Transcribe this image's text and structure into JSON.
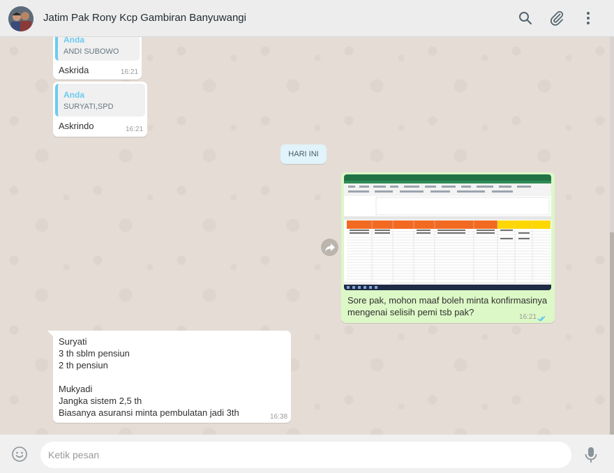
{
  "header": {
    "title": "Jatim Pak Rony Kcp Gambiran Banyuwangi",
    "icons": [
      "search-icon",
      "attach-icon",
      "menu-icon"
    ]
  },
  "messages": [
    {
      "quote_author": "Anda",
      "quote_text": "ANDI SUBOWO",
      "text": "Askrida",
      "time": "16:21"
    },
    {
      "quote_author": "Anda",
      "quote_text": "SURYATI,SPD",
      "text": "Askrindo",
      "time": "16:21"
    }
  ],
  "day_divider": "HARI INI",
  "outgoing": {
    "caption_line1": "Sore pak, mohon maaf boleh minta konfirmasinya",
    "caption_line2": "mengenai selisih pemi tsb pak?",
    "time": "16:21",
    "status_icon": "double-check-read-icon",
    "status_color": "#4fc3f7"
  },
  "incoming": {
    "lines": [
      "Suryati",
      "3 th sblm pensiun",
      "2 th pensiun",
      "",
      "Mukyadi",
      "Jangka sistem 2,5 th",
      "Biasanya asuransi minta pembulatan jadi 3th"
    ],
    "time": "16:38"
  },
  "composer": {
    "placeholder": "Ketik pesan"
  },
  "colors": {
    "outgoing_bubble": "#dcf8c6",
    "quote_accent": "#6bcbef",
    "background": "#e5ddd5"
  }
}
